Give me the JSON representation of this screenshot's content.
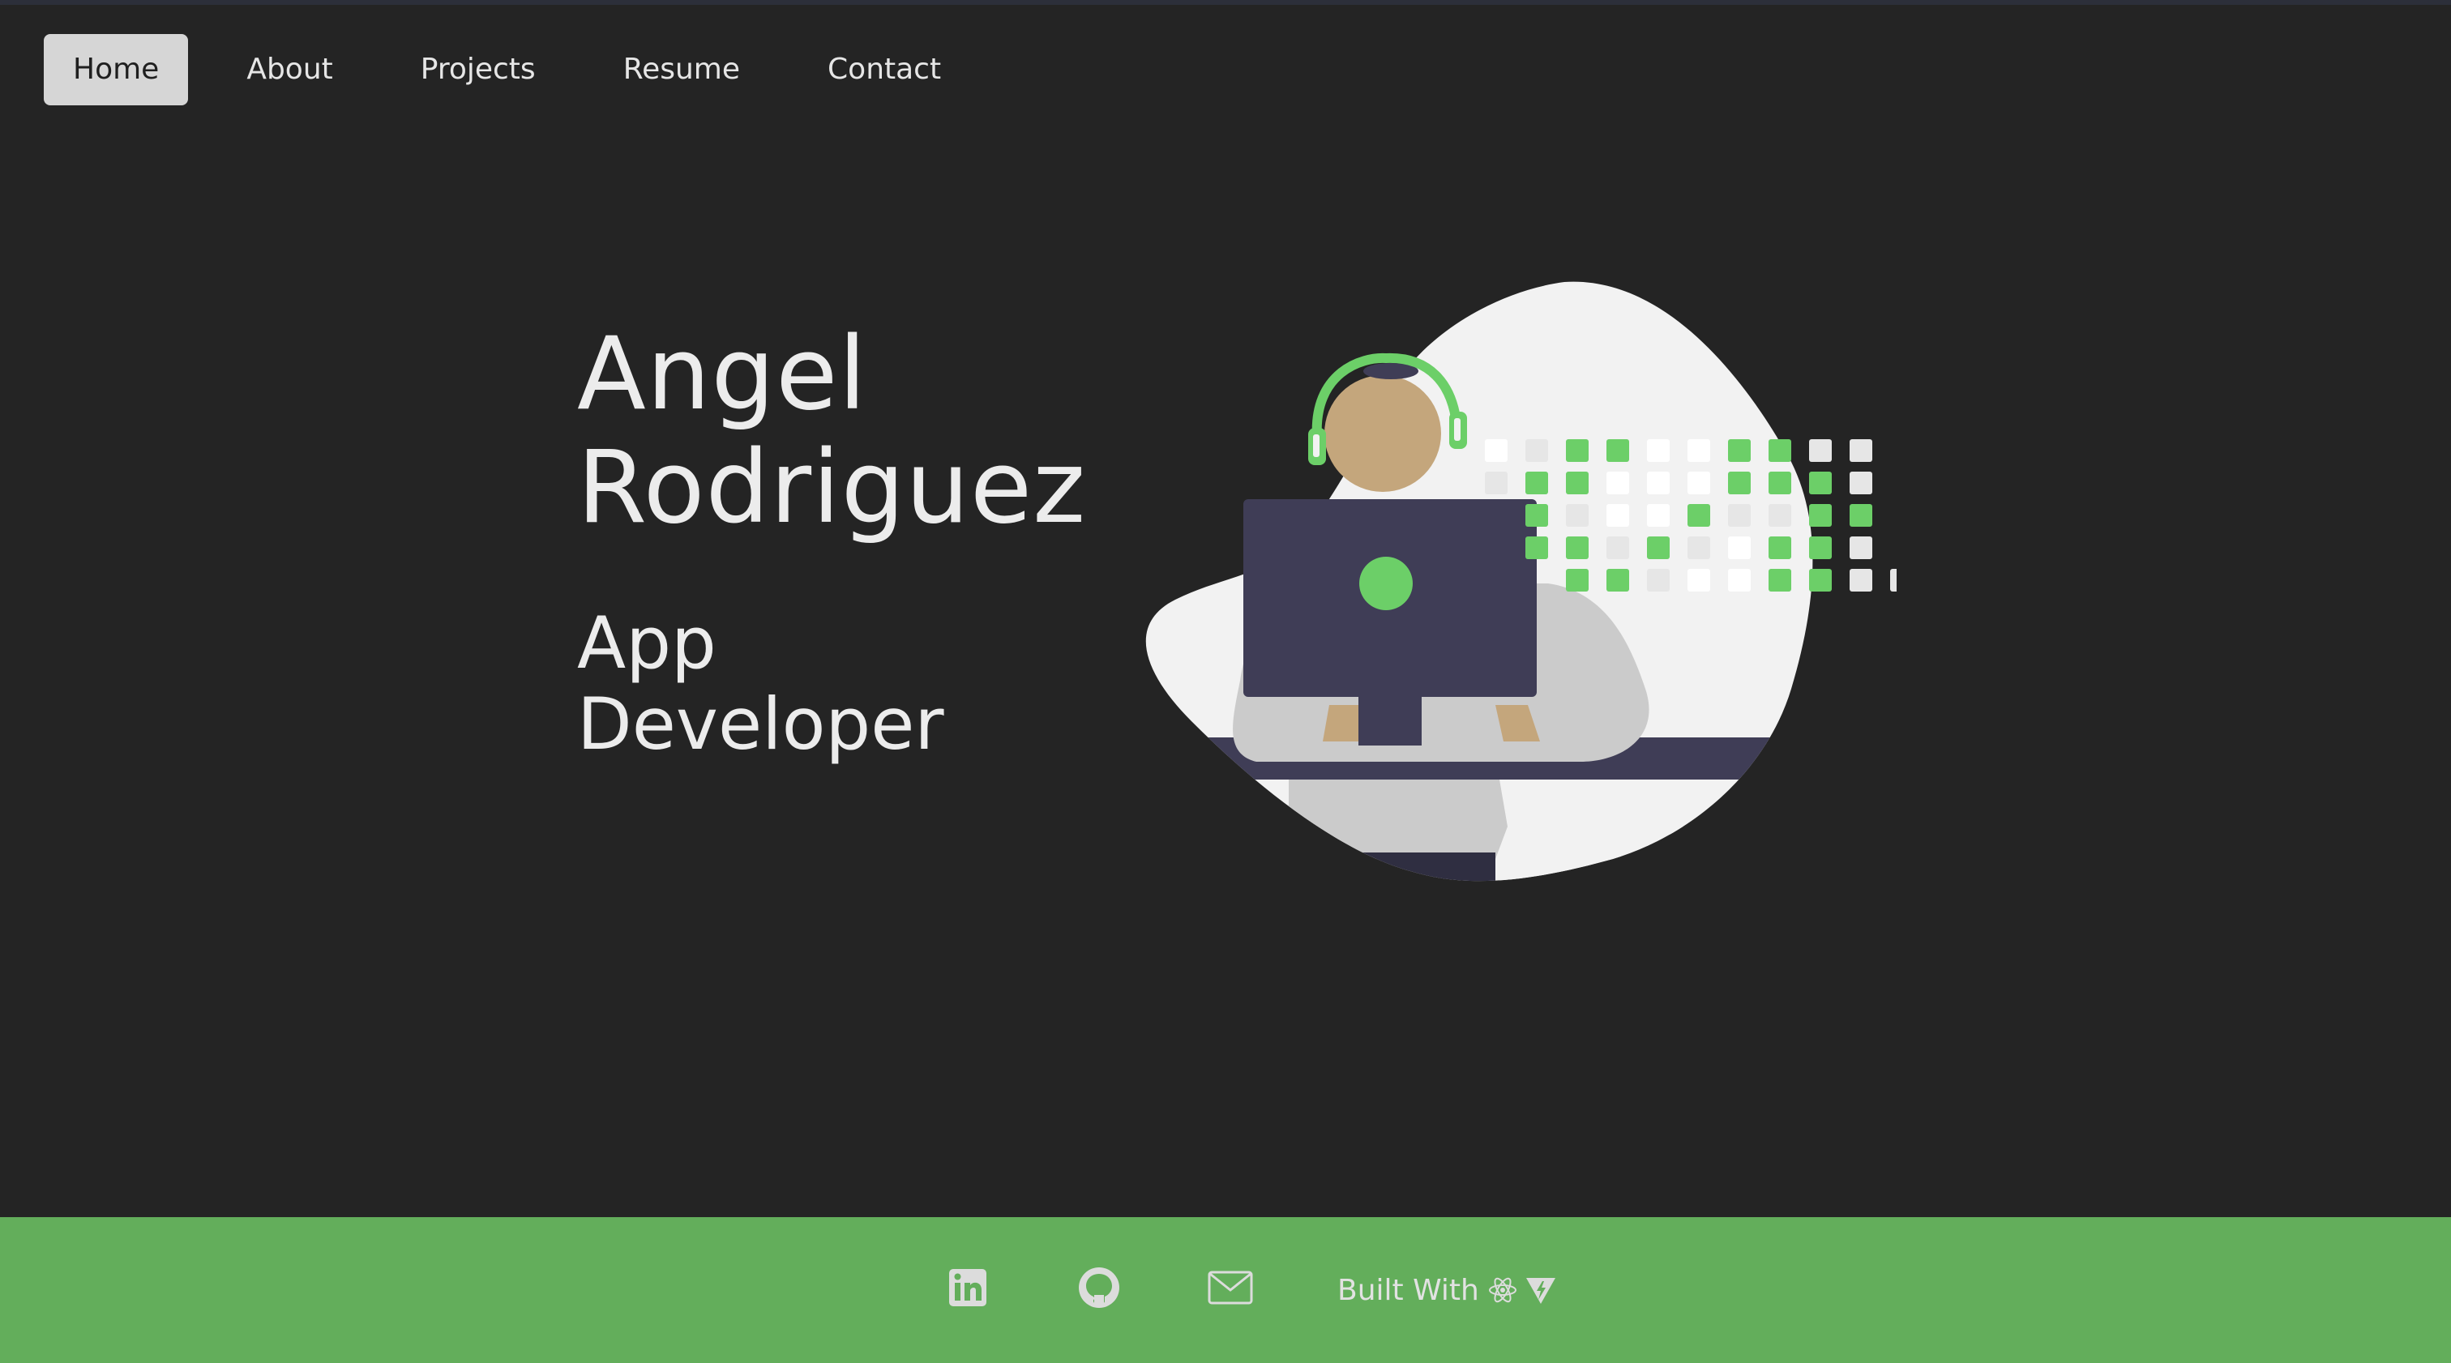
{
  "nav": {
    "items": [
      {
        "label": "Home",
        "active": true
      },
      {
        "label": "About",
        "active": false
      },
      {
        "label": "Projects",
        "active": false
      },
      {
        "label": "Resume",
        "active": false
      },
      {
        "label": "Contact",
        "active": false
      }
    ]
  },
  "hero": {
    "first_name": "Angel",
    "last_name": "Rodriguez",
    "role_line1": "App",
    "role_line2": "Developer",
    "illustration": "developer-at-computer-illustration"
  },
  "footer": {
    "links": [
      {
        "icon": "linkedin-icon"
      },
      {
        "icon": "github-icon"
      },
      {
        "icon": "mail-icon"
      }
    ],
    "built_with_label": "Built With",
    "built_with_icons": [
      "react-icon",
      "vite-icon"
    ]
  },
  "colors": {
    "background": "#242424",
    "footer": "#63ae5b",
    "accent_green": "#6ccf68",
    "nav_active_bg": "#d6d6d6",
    "text": "#ececec"
  }
}
